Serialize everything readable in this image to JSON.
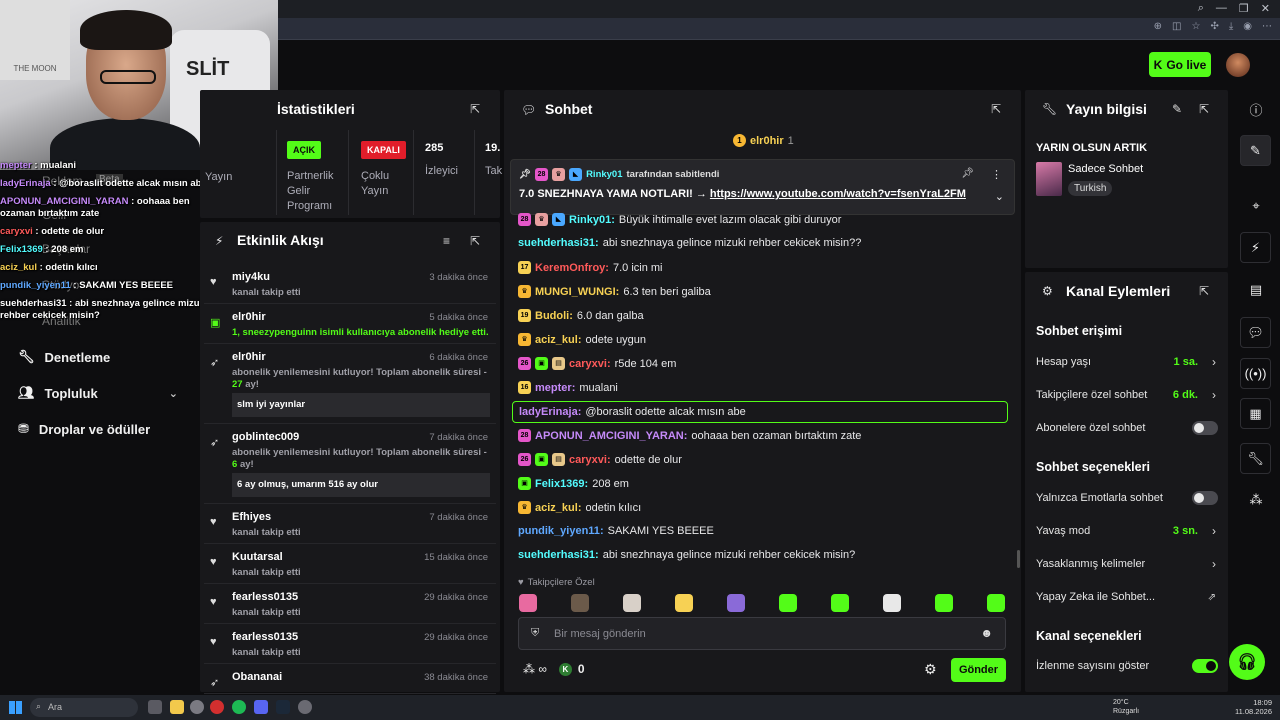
{
  "browser": {
    "icons": [
      "search-icon",
      "tab-icon",
      "minimize",
      "maximize",
      "close"
    ]
  },
  "header": {
    "go_live": "Go live"
  },
  "overlay_chat": [
    {
      "user": "mepter",
      "text": "mualani",
      "color": "#c58af9"
    },
    {
      "user": "ladyErinaja",
      "text": "@boraslit odette alcak mısın abe",
      "color": "#c58af9"
    },
    {
      "user": "APONUN_AMCIGINI_YARAN",
      "text": "oohaaa ben ozaman bırtaktım zate",
      "color": "#c58af9"
    },
    {
      "user": "caryxvi",
      "text": "odette de olur",
      "color": "#ff5a5a"
    },
    {
      "user": "Felix1369",
      "text": "208 em",
      "color": "#53fcff"
    },
    {
      "user": "aciz_kul",
      "text": "odetin kılıcı",
      "color": "#f7d154"
    },
    {
      "user": "pundik_yiyen11",
      "text": "SAKAMI YES BEEEE",
      "color": "#5fa8ff"
    },
    {
      "user": "suehderhasi31",
      "text": "abi snezhnaya gelince mizuki rehber cekicek misin?",
      "color": "#ffffff"
    }
  ],
  "sidebar": {
    "ghost_items": [
      "Reklam",
      "Beta",
      "Gelir",
      "Başarılar",
      "Stüdyo",
      "Analitik"
    ],
    "items": [
      {
        "label": "Denetleme"
      },
      {
        "label": "Topluluk"
      },
      {
        "label": "Droplar ve ödüller"
      }
    ]
  },
  "stats": {
    "title": "İstatistikleri",
    "cols": [
      {
        "label": "Yayın"
      },
      {
        "badge": "AÇIK",
        "label": "Partnerlik Gelir Programı"
      },
      {
        "badge": "KAPALI",
        "label": "Çoklu Yayın"
      },
      {
        "number": "285",
        "label": "İzleyici"
      },
      {
        "number": "19.",
        "label": "Tak"
      }
    ]
  },
  "activity": {
    "title": "Etkinlik Akışı",
    "rows": [
      {
        "user": "miy4ku",
        "time": "3 dakika önce",
        "desc": "kanalı takip etti"
      },
      {
        "user": "elr0hir",
        "time": "5 dakika önce",
        "desc": "1, sneezypenguinn isimli kullanıcıya abonelik hediye etti."
      },
      {
        "user": "elr0hir",
        "time": "6 dakika önce",
        "desc_pre": "abonelik yenilemesini kutluyor! Toplam abonelik süresi - ",
        "desc_num": "27",
        "desc_post": "ay!",
        "msg": "slm iyi yayınlar"
      },
      {
        "user": "goblintec009",
        "time": "7 dakika önce",
        "desc_pre": "abonelik yenilemesini kutluyor! Toplam abonelik süresi - ",
        "desc_num": "6",
        "desc_post": "ay!",
        "msg": "6 ay olmuş, umarım 516 ay olur"
      },
      {
        "user": "Efhiyes",
        "time": "7 dakika önce",
        "desc": "kanalı takip etti"
      },
      {
        "user": "Kuutarsal",
        "time": "15 dakika önce",
        "desc": "kanalı takip etti"
      },
      {
        "user": "fearless0135",
        "time": "29 dakika önce",
        "desc": "kanalı takip etti"
      },
      {
        "user": "fearless0135",
        "time": "29 dakika önce",
        "desc": "kanalı takip etti"
      },
      {
        "user": "Obananai",
        "time": "38 dakika önce",
        "desc": ""
      }
    ]
  },
  "chat": {
    "title": "Sohbet",
    "top_gifter": {
      "user": "elr0hir",
      "count": "1"
    },
    "pinned": {
      "by": "Rinky01",
      "by_suffix": "tarafından sabitlendi",
      "text": "7.0 SNEZHNAYA YAMA NOTLARI! → ",
      "link": "https://www.youtube.com/watch?v=fsenYraL2FM"
    },
    "messages": [
      {
        "user": "Rinky01",
        "text": "Büyük ihtimalle evet lazım olacak gibi duruyor",
        "color": "#53fcff",
        "badges": [
          {
            "t": "28",
            "c": "#e456c9"
          },
          {
            "t": "♛",
            "c": "#e8a0a0"
          },
          {
            "t": "◣",
            "c": "#4aa8ff"
          }
        ]
      },
      {
        "user": "suehderhasi31",
        "text": "abi snezhnaya gelince mizuki rehber cekicek misin??",
        "color": "#53fcff",
        "badges": []
      },
      {
        "user": "KeremOnfroy",
        "text": "7.0 icin mi",
        "color": "#ff5a5a",
        "badges": [
          {
            "t": "17",
            "c": "#f7d154"
          }
        ]
      },
      {
        "user": "MUNGI_WUNGI",
        "text": "6.3 ten beri galiba",
        "color": "#f7d154",
        "badges": [
          {
            "t": "♛",
            "c": "#f7b733"
          }
        ]
      },
      {
        "user": "Budoli",
        "text": "6.0 dan galba",
        "color": "#f7d154",
        "badges": [
          {
            "t": "19",
            "c": "#f7d154"
          }
        ]
      },
      {
        "user": "aciz_kul",
        "text": "odete uygun",
        "color": "#f7d154",
        "badges": [
          {
            "t": "♛",
            "c": "#f7b733"
          }
        ]
      },
      {
        "user": "caryxvi",
        "text": "r5de 104 em",
        "color": "#ff5a5a",
        "badges": [
          {
            "t": "26",
            "c": "#e456c9"
          },
          {
            "t": "▣",
            "c": "#53fc18"
          },
          {
            "t": "▤",
            "c": "#e8c88a"
          }
        ]
      },
      {
        "user": "mepter",
        "text": "mualani",
        "color": "#c58af9",
        "badges": [
          {
            "t": "16",
            "c": "#f7d154"
          }
        ]
      },
      {
        "user": "ladyErinaja",
        "text": "@boraslit odette alcak mısın abe",
        "color": "#c58af9",
        "badges": [],
        "highlight": true
      },
      {
        "user": "APONUN_AMCIGINI_YARAN",
        "text": "oohaaa ben ozaman bırtaktım zate",
        "color": "#c58af9",
        "badges": [
          {
            "t": "28",
            "c": "#e456c9"
          }
        ]
      },
      {
        "user": "caryxvi",
        "text": "odette de olur",
        "color": "#ff5a5a",
        "badges": [
          {
            "t": "26",
            "c": "#e456c9"
          },
          {
            "t": "▣",
            "c": "#53fc18"
          },
          {
            "t": "▤",
            "c": "#e8c88a"
          }
        ]
      },
      {
        "user": "Felix1369",
        "text": "208 em",
        "color": "#53fcff",
        "badges": [
          {
            "t": "▣",
            "c": "#53fc18"
          }
        ]
      },
      {
        "user": "aciz_kul",
        "text": "odetin kılıcı",
        "color": "#f7d154",
        "badges": [
          {
            "t": "♛",
            "c": "#f7b733"
          }
        ]
      },
      {
        "user": "pundik_yiyen11",
        "text": "SAKAMI YES BEEEE",
        "color": "#5fa8ff",
        "badges": []
      },
      {
        "user": "suehderhasi31",
        "text": "abi snezhnaya gelince mizuki rehber cekicek misin?",
        "color": "#53fcff",
        "badges": []
      }
    ],
    "emote_label": "Takipçilere Özel",
    "emote_colors": [
      "#e86aa0",
      "#6b5a4a",
      "#d8d0c8",
      "#f7d154",
      "#8a6ad8",
      "#53fc18",
      "#53fc18",
      "#e8e8e8",
      "#53fc18",
      "#53fc18"
    ],
    "placeholder": "Bir mesaj gönderin",
    "points": "0",
    "send": "Gönder"
  },
  "stream_info": {
    "title": "Yayın bilgisi",
    "stream_title": "YARIN OLSUN ARTIK",
    "category": "Sadece Sohbet",
    "tag": "Turkish"
  },
  "channel_actions": {
    "title": "Kanal Eylemleri",
    "chat_access": "Sohbet erişimi",
    "account_age": {
      "label": "Hesap yaşı",
      "value": "1 sa."
    },
    "followers_only": {
      "label": "Takipçilere özel sohbet",
      "value": "6 dk."
    },
    "subscribers_only": {
      "label": "Abonelere özel sohbet"
    },
    "chat_options": "Sohbet seçenekleri",
    "emotes_only": {
      "label": "Yalnızca Emotlarla sohbet"
    },
    "slow_mode": {
      "label": "Yavaş mod",
      "value": "3 sn."
    },
    "banned_words": {
      "label": "Yasaklanmış kelimeler"
    },
    "ai_chat": {
      "label": "Yapay Zeka ile Sohbet..."
    },
    "channel_options": "Kanal seçenekleri",
    "show_views": {
      "label": "İzlenme sayısını göster"
    }
  },
  "taskbar": {
    "search": "Ara",
    "weather_temp": "20°C",
    "weather_desc": "Rüzgarlı",
    "time": "18:09",
    "date": "11.08.2026"
  }
}
